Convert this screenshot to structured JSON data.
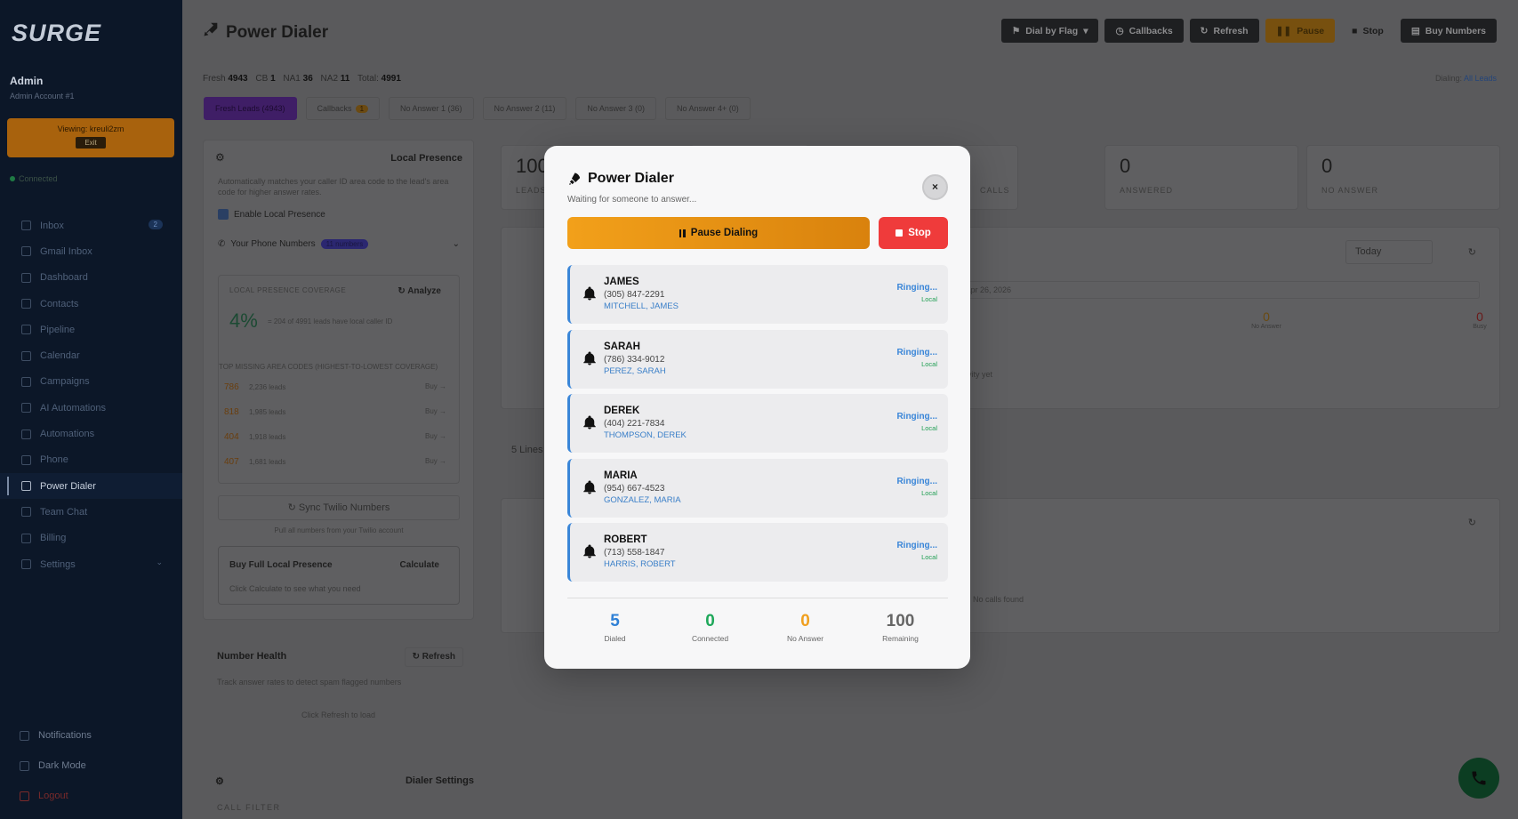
{
  "sidebar": {
    "logo": "SURGE",
    "user_name": "Admin",
    "user_sub": "Admin Account #1",
    "viewing": "Viewing: kreuli2zm",
    "exit": "Exit",
    "status": "Connected",
    "items": [
      {
        "label": "Inbox",
        "badge": "2",
        "icon": "inbox-icon"
      },
      {
        "label": "Gmail Inbox",
        "icon": "mail-icon"
      },
      {
        "label": "Dashboard",
        "icon": "chart-icon"
      },
      {
        "label": "Contacts",
        "icon": "contacts-icon"
      },
      {
        "label": "Pipeline",
        "icon": "pipeline-icon"
      },
      {
        "label": "Calendar",
        "icon": "calendar-icon"
      },
      {
        "label": "Campaigns",
        "icon": "megaphone-icon"
      },
      {
        "label": "AI Automations",
        "icon": "robot-icon"
      },
      {
        "label": "Automations",
        "icon": "wand-icon"
      },
      {
        "label": "Phone",
        "icon": "phone-icon"
      },
      {
        "label": "Power Dialer",
        "icon": "rocket-icon",
        "active": true
      },
      {
        "label": "Team Chat",
        "icon": "chat-icon"
      },
      {
        "label": "Billing",
        "icon": "billing-icon"
      },
      {
        "label": "Settings",
        "icon": "gear-icon"
      }
    ],
    "bottom": {
      "notifications": "Notifications",
      "dark_mode": "Dark Mode",
      "logout": "Logout"
    }
  },
  "header": {
    "title": "Power Dialer",
    "buttons": {
      "dial_by_flag": "Dial by Flag",
      "callbacks": "Callbacks",
      "refresh": "Refresh",
      "pause": "Pause",
      "stop": "Stop",
      "buy_numbers": "Buy Numbers"
    },
    "stats": {
      "fresh_label": "Fresh",
      "fresh": "4943",
      "cb_label": "CB",
      "cb": "1",
      "na1_label": "NA1",
      "na1": "36",
      "na2_label": "NA2",
      "na2": "11",
      "total_label": "Total:",
      "total": "4991"
    },
    "dialing_label": "Dialing:",
    "dialing_value": "All Leads"
  },
  "tabs": {
    "fresh": "Fresh Leads (4943)",
    "callbacks": "Callbacks",
    "callbacks_badge": "1",
    "na1": "No Answer 1 (36)",
    "na2": "No Answer 2 (11)",
    "na3": "No Answer 3 (0)",
    "na4": "No Answer 4+ (0)"
  },
  "local_presence": {
    "title": "Local Presence",
    "desc": "Automatically matches your caller ID area code to the lead's area code for higher answer rates.",
    "enable": "Enable Local Presence",
    "your_numbers": "Your Phone Numbers",
    "numbers_count": "11 numbers",
    "coverage_label": "LOCAL PRESENCE COVERAGE",
    "analyze": "Analyze",
    "pct": "4%",
    "pct_note": "= 204 of 4991 leads have local caller ID",
    "top_missing": "TOP MISSING AREA CODES (HIGHEST-TO-LOWEST COVERAGE)",
    "codes": [
      {
        "code": "786",
        "leads": "2,236 leads",
        "buy": "Buy →"
      },
      {
        "code": "818",
        "leads": "1,985 leads",
        "buy": "Buy →"
      },
      {
        "code": "404",
        "leads": "1,918 leads",
        "buy": "Buy →"
      },
      {
        "code": "407",
        "leads": "1,681 leads",
        "buy": "Buy →"
      }
    ],
    "sync": "Sync Twilio Numbers",
    "sync_note": "Pull all numbers from your Twilio account",
    "buy_title": "Buy Full Local Presence",
    "calculate": "Calculate",
    "buy_note": "Click Calculate to see what you need"
  },
  "number_health": {
    "title": "Number Health",
    "refresh": "Refresh",
    "desc": "Track answer rates to detect spam flagged numbers",
    "click": "Click Refresh to load"
  },
  "dialer_settings": {
    "title": "Dialer Settings",
    "call_filter": "CALL FILTER"
  },
  "background_stats": {
    "leads_num": "100",
    "leads_lbl": "LEADS",
    "calls_lbl": "CALLS",
    "answered_num": "0",
    "answered_lbl": "ANSWERED",
    "noanswer_num": "0",
    "noanswer_lbl": "NO ANSWER",
    "today": "Today",
    "date": "Sunday Apr 26, 2026",
    "noans_small_num": "0",
    "noans_small": "No Answer",
    "busy_num": "0",
    "busy": "Busy",
    "no_activity": "No call activity yet",
    "lines": "5 Lines",
    "no_calls": "No calls found"
  },
  "modal": {
    "title": "Power Dialer",
    "subtitle": "Waiting for someone to answer...",
    "close": "×",
    "pause": "Pause Dialing",
    "stop": "Stop",
    "calls": [
      {
        "name": "JAMES",
        "phone": "(305) 847-2291",
        "lead": "MITCHELL, JAMES",
        "status": "Ringing...",
        "tag": "Local"
      },
      {
        "name": "SARAH",
        "phone": "(786) 334-9012",
        "lead": "PEREZ, SARAH",
        "status": "Ringing...",
        "tag": "Local"
      },
      {
        "name": "DEREK",
        "phone": "(404) 221-7834",
        "lead": "THOMPSON, DEREK",
        "status": "Ringing...",
        "tag": "Local"
      },
      {
        "name": "MARIA",
        "phone": "(954) 667-4523",
        "lead": "GONZALEZ, MARIA",
        "status": "Ringing...",
        "tag": "Local"
      },
      {
        "name": "ROBERT",
        "phone": "(713) 558-1847",
        "lead": "HARRIS, ROBERT",
        "status": "Ringing...",
        "tag": "Local"
      }
    ],
    "stats": [
      {
        "value": "5",
        "label": "Dialed",
        "color": "#2f80d6"
      },
      {
        "value": "0",
        "label": "Connected",
        "color": "#1fa85a"
      },
      {
        "value": "0",
        "label": "No Answer",
        "color": "#f0a020"
      },
      {
        "value": "100",
        "label": "Remaining",
        "color": "#666666"
      }
    ]
  }
}
